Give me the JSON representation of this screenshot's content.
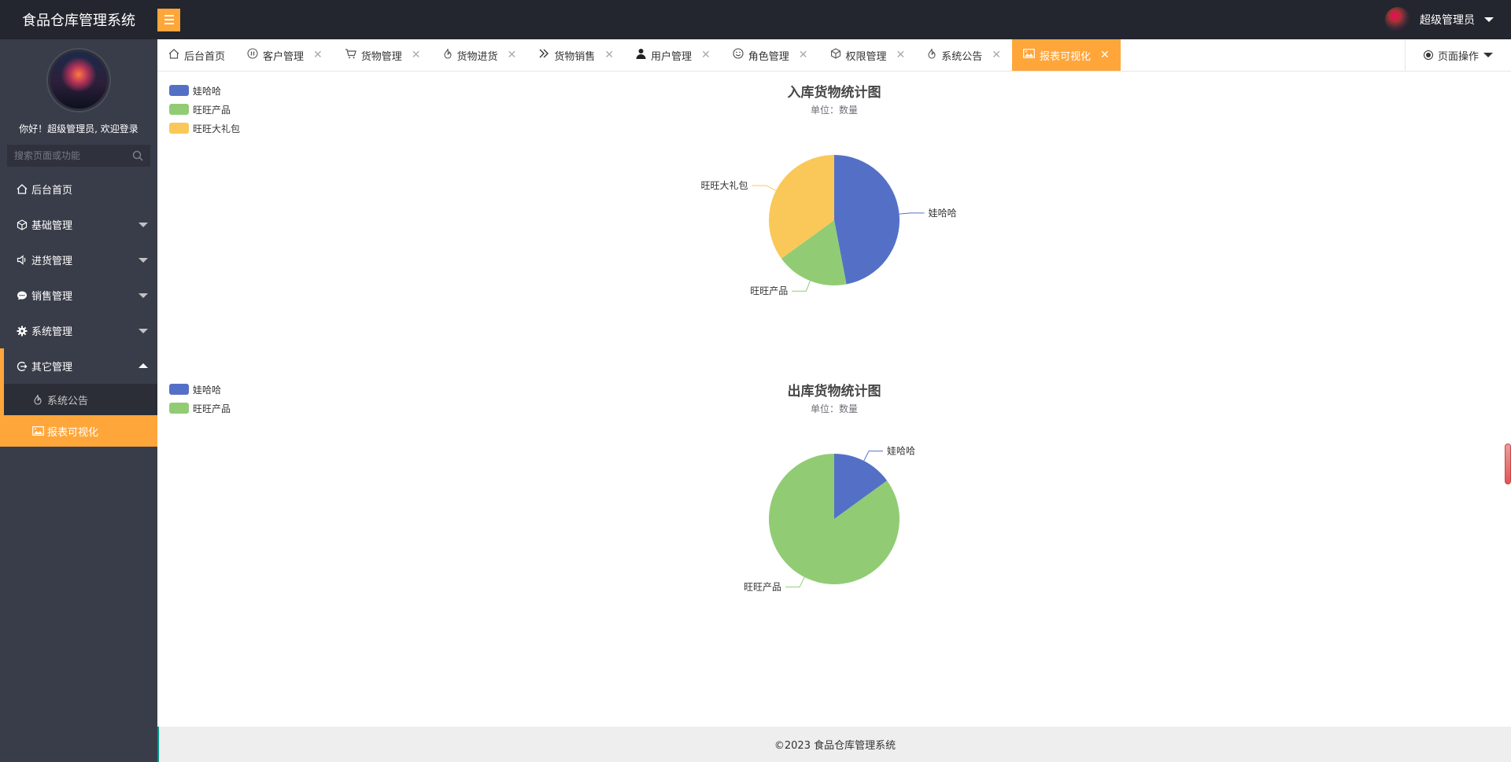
{
  "app": {
    "title": "食品仓库管理系统",
    "user_name": "超级管理员"
  },
  "sidebar": {
    "greeting": "你好！超级管理员, 欢迎登录",
    "search_placeholder": "搜索页面或功能",
    "items": [
      {
        "label": "后台首页",
        "icon": "home-icon"
      },
      {
        "label": "基础管理",
        "icon": "cube-icon"
      },
      {
        "label": "进货管理",
        "icon": "speaker-icon"
      },
      {
        "label": "销售管理",
        "icon": "chat-icon"
      },
      {
        "label": "系统管理",
        "icon": "gear-icon"
      },
      {
        "label": "其它管理",
        "icon": "logout-icon"
      }
    ],
    "sub_items": [
      {
        "label": "系统公告",
        "icon": "fire-icon"
      },
      {
        "label": "报表可视化",
        "icon": "picture-icon"
      }
    ]
  },
  "tabs": [
    {
      "label": "后台首页",
      "icon": "home-icon"
    },
    {
      "label": "客户管理",
      "icon": "pause-icon"
    },
    {
      "label": "货物管理",
      "icon": "cart-icon"
    },
    {
      "label": "货物进货",
      "icon": "fire-icon"
    },
    {
      "label": "货物销售",
      "icon": "double-right-icon"
    },
    {
      "label": "用户管理",
      "icon": "user-icon"
    },
    {
      "label": "角色管理",
      "icon": "smile-icon"
    },
    {
      "label": "权限管理",
      "icon": "cube-icon"
    },
    {
      "label": "系统公告",
      "icon": "fire-icon"
    },
    {
      "label": "报表可视化",
      "icon": "picture-icon"
    }
  ],
  "page_ops": {
    "label": "页面操作"
  },
  "colors": {
    "accent": "#ffa63b",
    "series1": "#5470c6",
    "series2": "#91cc75",
    "series3": "#fac858"
  },
  "chart_data": [
    {
      "type": "pie",
      "title": "入库货物统计图",
      "subtitle": "单位：数量",
      "legend_position": "top-left",
      "series": [
        {
          "name": "娃哈哈",
          "value": 47
        },
        {
          "name": "旺旺产品",
          "value": 18
        },
        {
          "name": "旺旺大礼包",
          "value": 35
        }
      ]
    },
    {
      "type": "pie",
      "title": "出库货物统计图",
      "subtitle": "单位：数量",
      "legend_position": "top-left",
      "series": [
        {
          "name": "娃哈哈",
          "value": 15
        },
        {
          "name": "旺旺产品",
          "value": 85
        }
      ]
    }
  ],
  "footer": {
    "text": "©2023 食品仓库管理系统"
  }
}
